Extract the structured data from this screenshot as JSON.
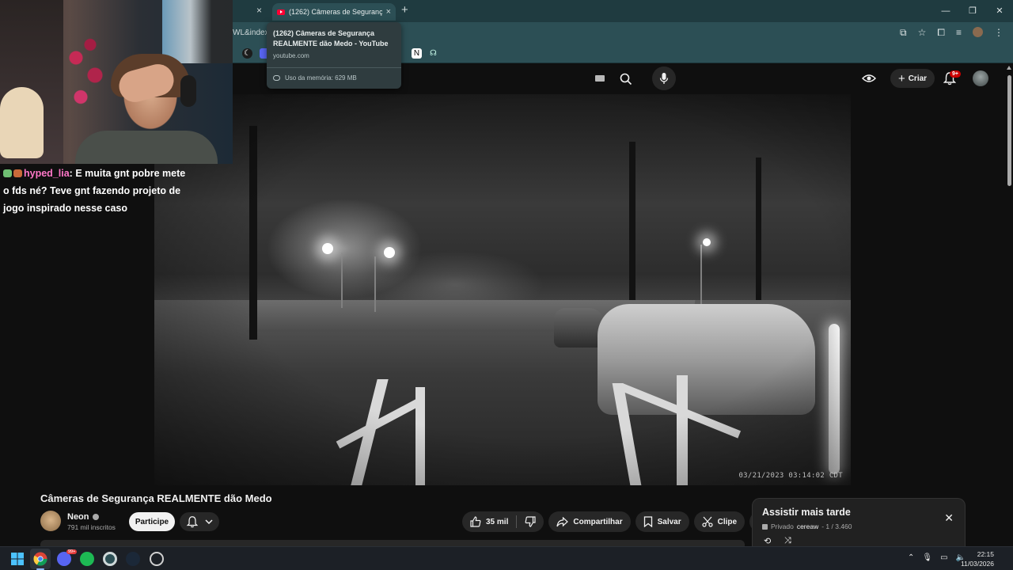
{
  "browser": {
    "prev_tab_close": "×",
    "active_tab": {
      "title": "(1262) Câmeras de Segurança R",
      "close": "×"
    },
    "new_tab": "+",
    "address_partial": "WL&index=",
    "window_controls": [
      "—",
      "❐",
      "✕"
    ]
  },
  "tooltip": {
    "title": "(1262) Câmeras de Segurança REALMENTE dão Medo - YouTube",
    "domain": "youtube.com",
    "memory": "Uso da memória: 629 MB"
  },
  "youtube_header": {
    "create_label": "Criar",
    "notifications_badge": "9+"
  },
  "video": {
    "timestamp": "03/21/2023 03:14:02 CDT"
  },
  "chat": {
    "username": "hyped_lia",
    "message": "E muita gnt pobre mete o fds né? Teve gnt fazendo projeto de jogo inspirado nesse caso"
  },
  "watch": {
    "title": "Câmeras de Segurança REALMENTE dão Medo",
    "channel_name": "Neon",
    "subscribers": "791 mil inscritos",
    "join_label": "Participe",
    "likes": "35 mil",
    "share_label": "Compartilhar",
    "save_label": "Salvar",
    "clip_label": "Clipe",
    "more_label": "···"
  },
  "playlist_panel": {
    "title": "Assistir mais tarde",
    "privacy": "Privado",
    "owner": "cereaw",
    "position": "- 1 / 3.460",
    "close": "✕"
  },
  "taskbar": {
    "time": "22:15",
    "date": "11/03/2026",
    "discord_badge": "99+"
  },
  "colors": {
    "chrome_tabs_bg": "#1f3b40",
    "chrome_toolbar_bg": "#2c4f55",
    "youtube_bg": "#0f0f0f",
    "chat_username": "#ff77c8",
    "notification_red": "#cc0000"
  }
}
